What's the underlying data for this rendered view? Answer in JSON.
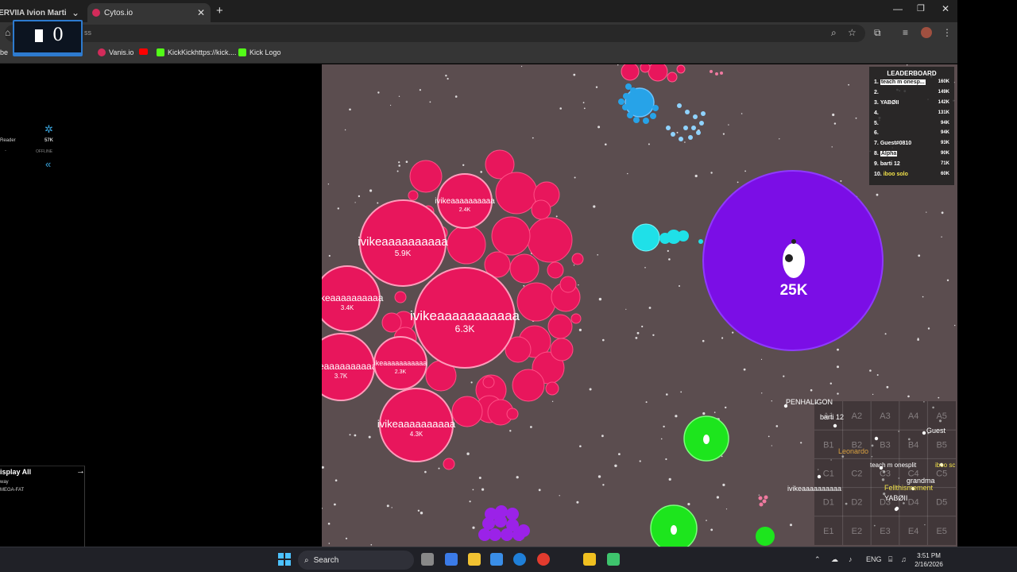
{
  "browser": {
    "tabs": [
      {
        "label": "TERVIIA Ivion Martinez",
        "active": false
      },
      {
        "label": "Cytos.io",
        "active": true
      }
    ],
    "new_tab_icon": "plus",
    "address_text": "ss",
    "bookmarks": [
      {
        "label": "be"
      },
      {
        "label": "Vanis.io"
      },
      {
        "label": ""
      },
      {
        "label": "KickKickhttps://kick...."
      },
      {
        "label": "Kick Logo"
      }
    ]
  },
  "overlay": {
    "count": "0"
  },
  "left_panel": {
    "reader_label": "Reader",
    "score": "57K",
    "status": "OFFLINE",
    "dash": "-",
    "collapse_icon": "«",
    "display_all": "isplay All",
    "arrow_icon": "→",
    "list": [
      "way",
      "MEGA-FAT"
    ]
  },
  "game": {
    "bg_color": "#5b4d4f",
    "player_color": "#e8165c",
    "player_name": "ivikeaaaaaaaaaa",
    "player_big_name": "ivikeaaaaaaaaaaa",
    "masses": {
      "a": "5.9K",
      "b": "3.4K",
      "c": "3.7K",
      "d": "4.3K",
      "e": "6.3K",
      "f": "2.4K",
      "g": "2.3K"
    },
    "partial_name": "ikeaaaaaaaaaaa",
    "purple_mass": "25K",
    "purple_color": "#7b0ee6"
  },
  "leaderboard": {
    "title": "LEADERBOARD",
    "rows": [
      {
        "rank": "1.",
        "name": "teach m onesp...",
        "score": "160K",
        "color": "#ffffff"
      },
      {
        "rank": "2.",
        "name": "",
        "score": "149K",
        "color": "#ffffff"
      },
      {
        "rank": "3.",
        "name": "YABØII",
        "score": "142K",
        "color": "#ffffff"
      },
      {
        "rank": "4.",
        "name": "",
        "score": "131K",
        "color": "#a14cff"
      },
      {
        "rank": "5.",
        "name": "",
        "score": "94K",
        "color": "#ffffff"
      },
      {
        "rank": "6.",
        "name": "",
        "score": "94K",
        "color": "#ffffff"
      },
      {
        "rank": "7.",
        "name": "Guest#0810",
        "score": "93K",
        "color": "#ffffff"
      },
      {
        "rank": "8.",
        "name": "Alpha",
        "score": "90K",
        "color": "#ffffff"
      },
      {
        "rank": "9.",
        "name": "barti 12",
        "score": "71K",
        "color": "#ffffff"
      },
      {
        "rank": "10.",
        "name": "iboo solo",
        "score": "60K",
        "color": "#f2e24a"
      }
    ]
  },
  "minimap": {
    "rows": [
      "A",
      "B",
      "C",
      "D",
      "E"
    ],
    "cols": [
      "1",
      "2",
      "3",
      "4",
      "5"
    ],
    "players": [
      {
        "name": "PENHALIGON",
        "color": "#ffffff"
      },
      {
        "name": "barti 12",
        "color": "#ffffff"
      },
      {
        "name": "Guest",
        "color": "#ffffff"
      },
      {
        "name": "Leonardo",
        "color": "#d8a040"
      },
      {
        "name": "teach m onesplit",
        "color": "#ffffff"
      },
      {
        "name": "iboo sc",
        "color": "#f2e24a"
      },
      {
        "name": "grandma",
        "color": "#ffffff"
      },
      {
        "name": "Fellthismement",
        "color": "#f2e24a"
      },
      {
        "name": "YABØII",
        "color": "#ffffff"
      },
      {
        "name": "ivikeaaaaaaaaaa",
        "color": "#ffffff"
      }
    ]
  },
  "taskbar": {
    "search_label": "Search",
    "lang": "ENG",
    "time": "3:51 PM",
    "date": "2/16/2026"
  }
}
